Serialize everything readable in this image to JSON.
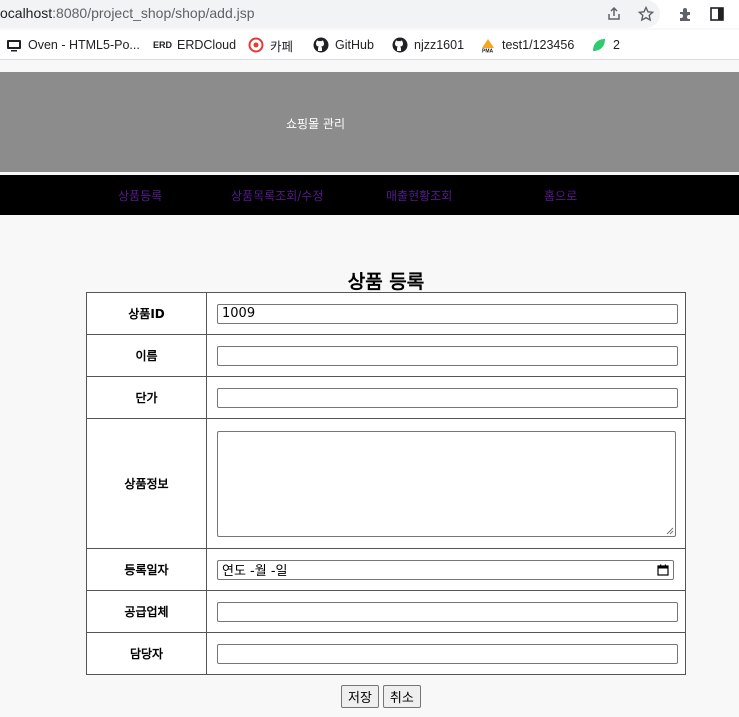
{
  "browser": {
    "url_host": "ocalhost",
    "url_path": ":8080/project_shop/shop/add.jsp",
    "bookmarks": [
      {
        "label": "Oven - HTML5-Po...",
        "icon": "monitor-icon"
      },
      {
        "label": "ERDCloud",
        "icon": "erd-icon"
      },
      {
        "label": "카페",
        "icon": "cafe-icon"
      },
      {
        "label": "GitHub",
        "icon": "github-icon"
      },
      {
        "label": "njzz1601",
        "icon": "github-icon"
      },
      {
        "label": "test1/123456",
        "icon": "pma-icon"
      },
      {
        "label": "2",
        "icon": "leaf-icon"
      }
    ]
  },
  "header": {
    "title": "쇼핑몰 관리"
  },
  "nav": [
    {
      "label": "상품등록"
    },
    {
      "label": "상품목록조회/수정"
    },
    {
      "label": "매출현황조회"
    },
    {
      "label": "홈으로"
    }
  ],
  "form": {
    "title": "상품 등록",
    "fields": {
      "product_id": {
        "label": "상품ID",
        "value": "1009"
      },
      "name": {
        "label": "이름",
        "value": ""
      },
      "price": {
        "label": "단가",
        "value": ""
      },
      "info": {
        "label": "상품정보",
        "value": ""
      },
      "date": {
        "label": "등록일자",
        "value": "연도 -월 -일"
      },
      "supplier": {
        "label": "공급업체",
        "value": ""
      },
      "manager": {
        "label": "담당자",
        "value": ""
      }
    },
    "save_label": "저장",
    "cancel_label": "취소"
  }
}
